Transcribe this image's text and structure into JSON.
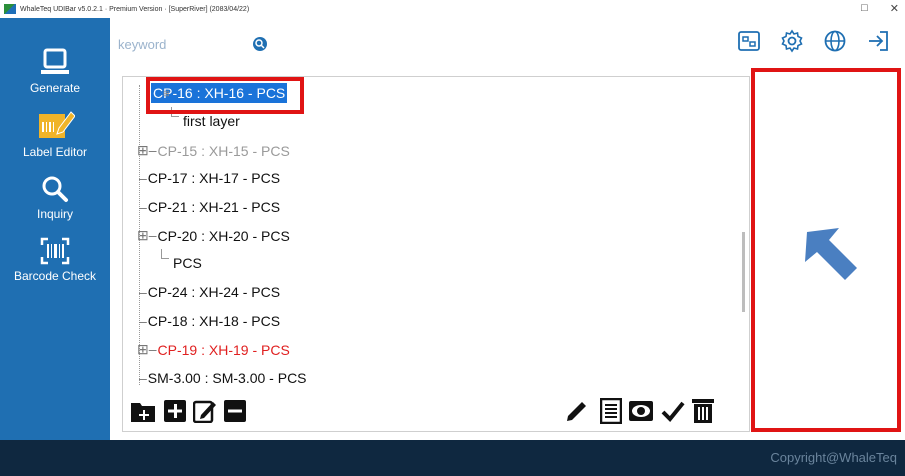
{
  "window": {
    "title": "WhaleTeq UDIBar v5.0.2.1 · Premium Version · [SuperRiver] (2083/04/22)",
    "controls": [
      "restore",
      "close"
    ]
  },
  "sidebar": {
    "items": [
      {
        "label": "Generate",
        "icon": "laptop-icon"
      },
      {
        "label": "Label Editor",
        "icon": "label-edit-icon"
      },
      {
        "label": "Inquiry",
        "icon": "magnifier-icon"
      },
      {
        "label": "Barcode Check",
        "icon": "barcode-scan-icon"
      }
    ]
  },
  "search": {
    "placeholder": "keyword",
    "value": ""
  },
  "topbar": {
    "icons": [
      "label-template-icon",
      "settings-gear-icon",
      "globe-language-icon",
      "logout-icon"
    ]
  },
  "tree": {
    "nodes": [
      {
        "label": "CP-16 : XH-16 - PCS",
        "state": "selected",
        "expandable": true
      },
      {
        "label": "first layer",
        "state": "child"
      },
      {
        "label": "CP-15 : XH-15 - PCS",
        "state": "grey",
        "expandable": true
      },
      {
        "label": "CP-17 : XH-17 - PCS",
        "state": "normal"
      },
      {
        "label": "CP-21 : XH-21 - PCS",
        "state": "normal"
      },
      {
        "label": "CP-20 : XH-20 - PCS",
        "state": "normal",
        "expandable": true
      },
      {
        "label": "PCS",
        "state": "child"
      },
      {
        "label": "CP-24 : XH-24 - PCS",
        "state": "normal"
      },
      {
        "label": "CP-18 : XH-18 - PCS",
        "state": "normal"
      },
      {
        "label": "CP-19 : XH-19 - PCS",
        "state": "red",
        "expandable": true
      },
      {
        "label": "SM-3.00 : SM-3.00 - PCS",
        "state": "normal"
      }
    ]
  },
  "toolbar": {
    "left": [
      "add-folder-icon",
      "add-item-icon",
      "edit-item-icon",
      "remove-item-icon"
    ],
    "right": [
      "pencil-icon",
      "list-document-icon",
      "eye-preview-icon",
      "checkmark-icon",
      "trash-icon"
    ]
  },
  "colors": {
    "sidebar": "#1f6fb2",
    "selection": "#1a73d9",
    "highlight": "#e01414",
    "footer": "#0f2840",
    "arrow": "#4a7fc1"
  },
  "footer": {
    "copyright": "Copyright@WhaleTeq"
  }
}
